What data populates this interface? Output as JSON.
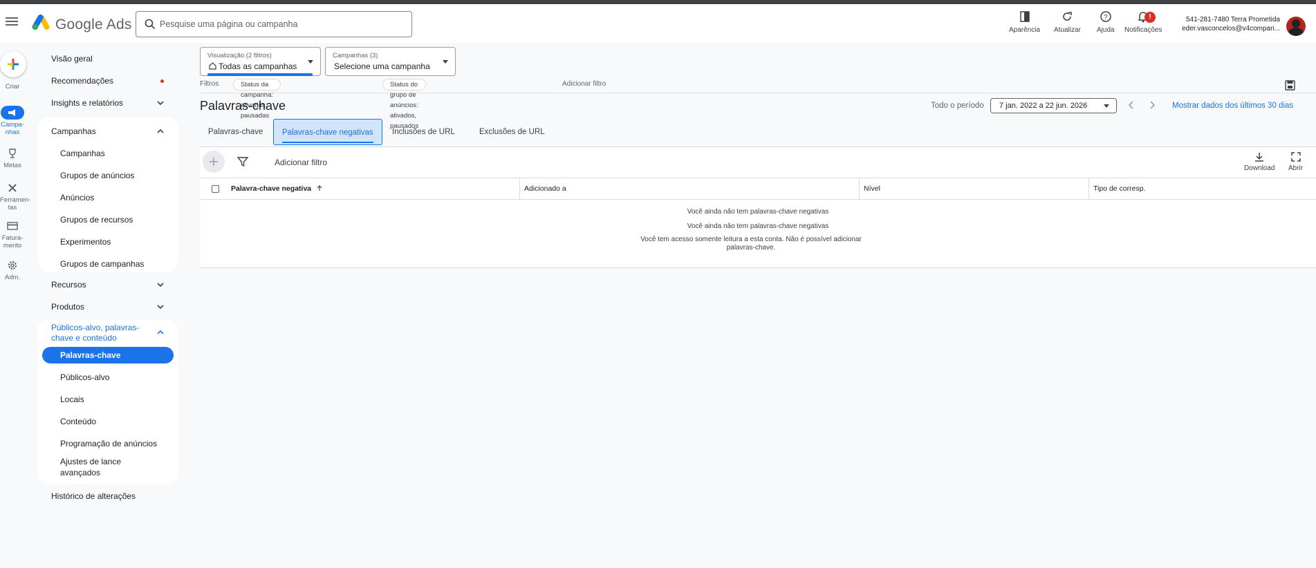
{
  "app": {
    "brand": "Google Ads"
  },
  "search": {
    "placeholder": "Pesquise uma página ou campanha"
  },
  "toolbar": {
    "appearance": "Aparência",
    "refresh": "Atualizar",
    "help": "Ajuda",
    "notifications": "Notificações",
    "notifications_badge": "!"
  },
  "account": {
    "line1": "541-281-7480 Terra Prometida",
    "line2": "eder.vasconcelos@v4compan..."
  },
  "rail": {
    "create": "Criar",
    "campaigns": "Campa-\nnhas",
    "goals": "Metas",
    "tools": "Ferramen-\ntas",
    "billing": "Fatura-\nmento",
    "admin": "Adm."
  },
  "nav": {
    "overview": "Visão geral",
    "recommendations": "Recomendações",
    "insights": "Insights e relatórios",
    "campaigns_group": "Campanhas",
    "campaigns_items": [
      "Campanhas",
      "Grupos de anúncios",
      "Anúncios",
      "Grupos de recursos",
      "Experimentos",
      "Grupos de campanhas"
    ],
    "resources": "Recursos",
    "products": "Produtos",
    "audiences_group": "Públicos-alvo, palavras-chave e conteúdo",
    "audiences_items": [
      "Palavras-chave",
      "Públicos-alvo",
      "Locais",
      "Conteúdo",
      "Programação de anúncios",
      "Ajustes de lance avançados"
    ],
    "change_history": "Histórico de alterações"
  },
  "view": {
    "label": "Visualização (2 filtros)",
    "value": "Todas as campanhas"
  },
  "campaigns_select": {
    "label": "Campanhas (3)",
    "value": "Selecione uma campanha"
  },
  "filters": {
    "label": "Filtros",
    "chip1": "Status da campanha: ativadas, pausadas",
    "chip2": "Status do grupo de anúncios: ativados, pausados",
    "add": "Adicionar filtro"
  },
  "page": {
    "title": "Palavras-chave",
    "period_label": "Todo o período",
    "date_range": "7 jan. 2022 a 22 jun. 2026",
    "last30": "Mostrar dados dos últimos 30 dias"
  },
  "tabs": [
    "Palavras-chave",
    "Palavras-chave negativas",
    "Inclusões de URL",
    "Exclusões de URL"
  ],
  "table": {
    "add_filter": "Adicionar filtro",
    "download": "Download",
    "open": "Abrir",
    "columns": [
      "Palavra-chave negativa",
      "Adicionado a",
      "Nível",
      "Tipo de corresp."
    ],
    "empty1": "Você ainda não tem palavras-chave negativas",
    "empty2": "Você ainda não tem palavras-chave negativas",
    "empty3": "Você tem acesso somente leitura a esta conta. Não é possível adicionar palavras-chave."
  },
  "colors": {
    "accent": "#1a73e8",
    "alert": "#d93025"
  }
}
